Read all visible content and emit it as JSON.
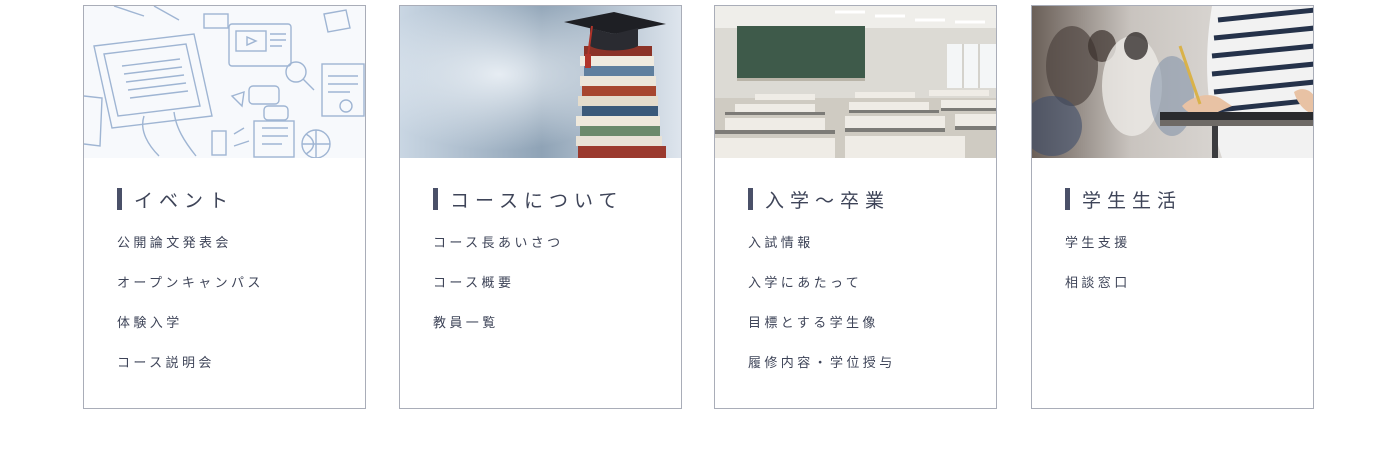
{
  "cards": [
    {
      "image": "event-illustration-icon",
      "title": "イベント",
      "links": [
        "公開論文発表会",
        "オープンキャンパス",
        "体験入学",
        "コース説明会"
      ]
    },
    {
      "image": "graduation-books-icon",
      "title": "コースについて",
      "links": [
        "コース長あいさつ",
        "コース概要",
        "教員一覧"
      ]
    },
    {
      "image": "classroom-photo-icon",
      "title": "入学〜卒業",
      "links": [
        "入試情報",
        "入学にあたって",
        "目標とする学生像",
        "履修内容・学位授与"
      ]
    },
    {
      "image": "student-writing-photo-icon",
      "title": "学生生活",
      "links": [
        "学生支援",
        "相談窓口"
      ]
    }
  ],
  "colors": {
    "heading_bar": "#4a5068",
    "text": "#3e4458",
    "card_border": "#a9adb8",
    "illustration_line": "#9fb5d3"
  }
}
